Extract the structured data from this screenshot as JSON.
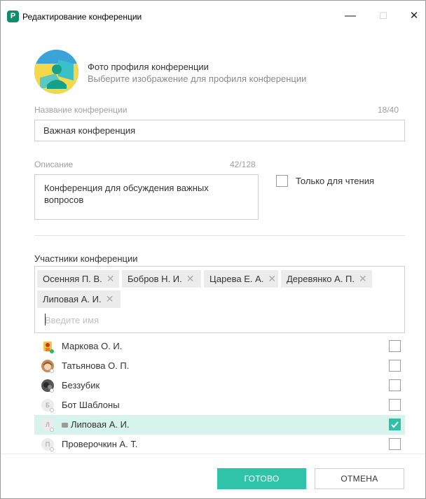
{
  "window": {
    "title": "Редактирование конференции",
    "app_icon_letter": "P",
    "minimize_glyph": "—",
    "maximize_glyph": "☐",
    "close_glyph": "✕"
  },
  "photo": {
    "title": "Фото профиля конференции",
    "subtitle": "Выберите изображение для профиля конференции",
    "icon": "conference-photo-icon"
  },
  "name_field": {
    "label": "Название конференции",
    "counter": "18/40",
    "value": "Важная конференция"
  },
  "description_field": {
    "label": "Описание",
    "counter": "42/128",
    "value": "Конференция для обсуждения важных вопросов"
  },
  "readonly": {
    "label": "Только для чтения",
    "checked": false
  },
  "members": {
    "title": "Участники конференции",
    "chips": [
      {
        "label": "Осенняя П. В."
      },
      {
        "label": "Бобров Н. И."
      },
      {
        "label": "Царева Е. А."
      },
      {
        "label": "Деревянко А. П."
      },
      {
        "label": "Липовая А. И."
      }
    ],
    "chip_remove_glyph": "✕",
    "search_placeholder": "Введите имя",
    "list": [
      {
        "name": "Маркова О. И.",
        "status": "online",
        "checked": false,
        "avatar": "photo",
        "initial": ""
      },
      {
        "name": "Татьянова О. П.",
        "status": "offline",
        "checked": false,
        "avatar": "photo",
        "initial": ""
      },
      {
        "name": "Беззубик",
        "status": "offline",
        "checked": false,
        "avatar": "photo",
        "initial": ""
      },
      {
        "name": "Бот Шаблоны",
        "status": "offline",
        "checked": false,
        "avatar": "initial",
        "initial": "Б"
      },
      {
        "name": "Липовая А. И.",
        "status": "offline",
        "checked": true,
        "avatar": "initial",
        "initial": "Л"
      },
      {
        "name": "Проверочкин А. Т.",
        "status": "offline",
        "checked": false,
        "avatar": "initial",
        "initial": "П"
      }
    ]
  },
  "buttons": {
    "done": "ГОТОВО",
    "cancel": "ОТМЕНА"
  },
  "colors": {
    "accent": "#2fc4aa",
    "selected_row": "#d6f3ee",
    "brand": "#0f8d6b",
    "online": "#35b35a"
  }
}
